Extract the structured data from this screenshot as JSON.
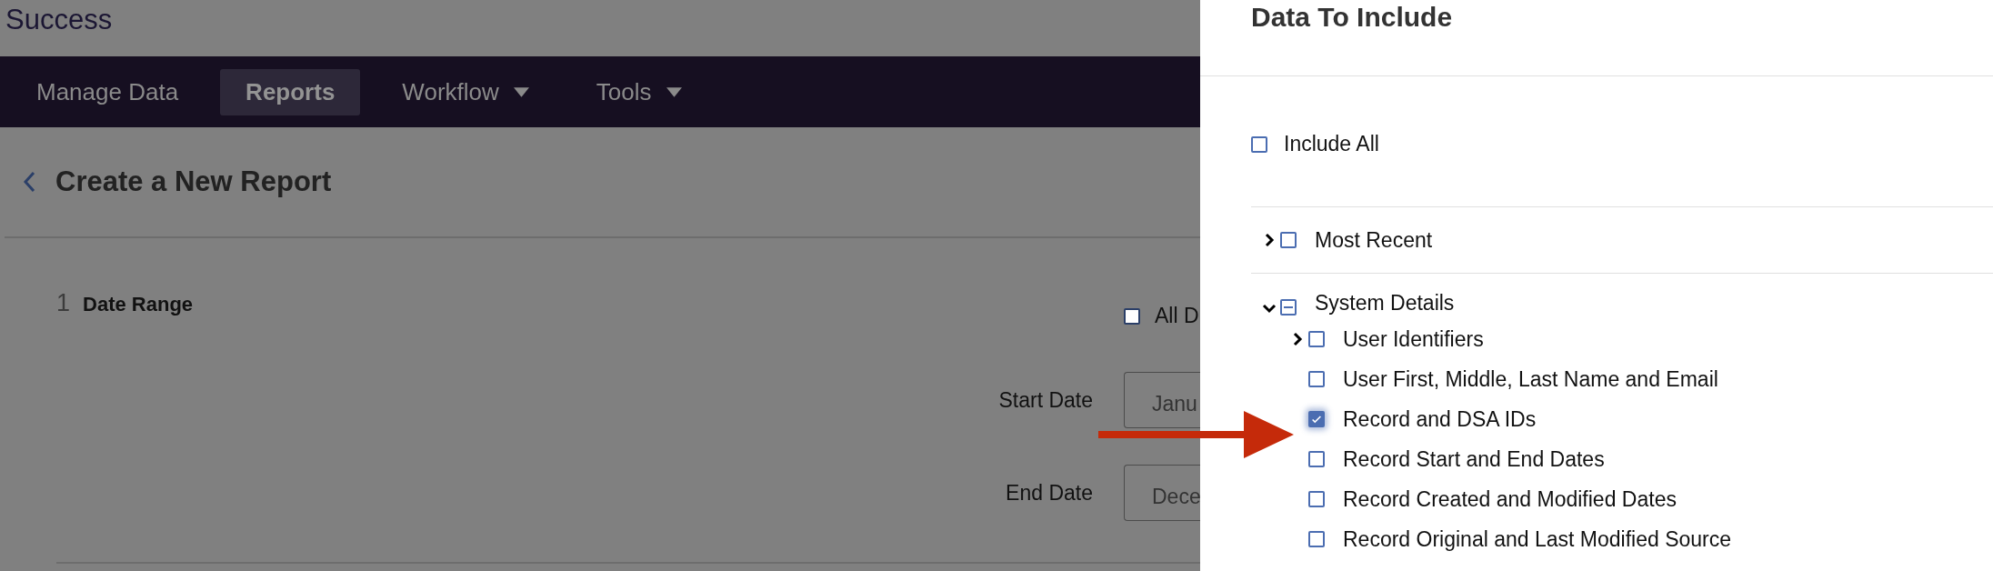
{
  "app_title": "Success",
  "nav": [
    {
      "label": "Manage Data",
      "selected": false,
      "dropdown": false
    },
    {
      "label": "Reports",
      "selected": true,
      "dropdown": false
    },
    {
      "label": "Workflow",
      "selected": false,
      "dropdown": true
    },
    {
      "label": "Tools",
      "selected": false,
      "dropdown": true
    }
  ],
  "page_title": "Create a New Report",
  "section": {
    "number": "1",
    "title": "Date Range",
    "all_dates": {
      "label": "All D",
      "checked": false
    },
    "fields": [
      {
        "label": "Start Date",
        "value": "Janu"
      },
      {
        "label": "End Date",
        "value": "Dece"
      }
    ]
  },
  "panel": {
    "title": "Data To Include",
    "include_all": {
      "label": "Include All",
      "checked": false
    },
    "tree": [
      {
        "label": "Most Recent",
        "kind": "group",
        "expanded": false,
        "checked": false
      },
      {
        "label": "System Details",
        "kind": "group",
        "expanded": true,
        "partial": true,
        "children": [
          {
            "label": "User Identifiers",
            "kind": "group",
            "expanded": false,
            "checked": false
          },
          {
            "label": "User First, Middle, Last Name and Email",
            "kind": "leaf",
            "checked": false
          },
          {
            "label": "Record and DSA IDs",
            "kind": "leaf",
            "checked": true
          },
          {
            "label": "Record Start and End Dates",
            "kind": "leaf",
            "checked": false
          },
          {
            "label": "Record Created and Modified Dates",
            "kind": "leaf",
            "checked": false
          },
          {
            "label": "Record Original and Last Modified Source",
            "kind": "leaf",
            "checked": false
          }
        ]
      }
    ]
  }
}
